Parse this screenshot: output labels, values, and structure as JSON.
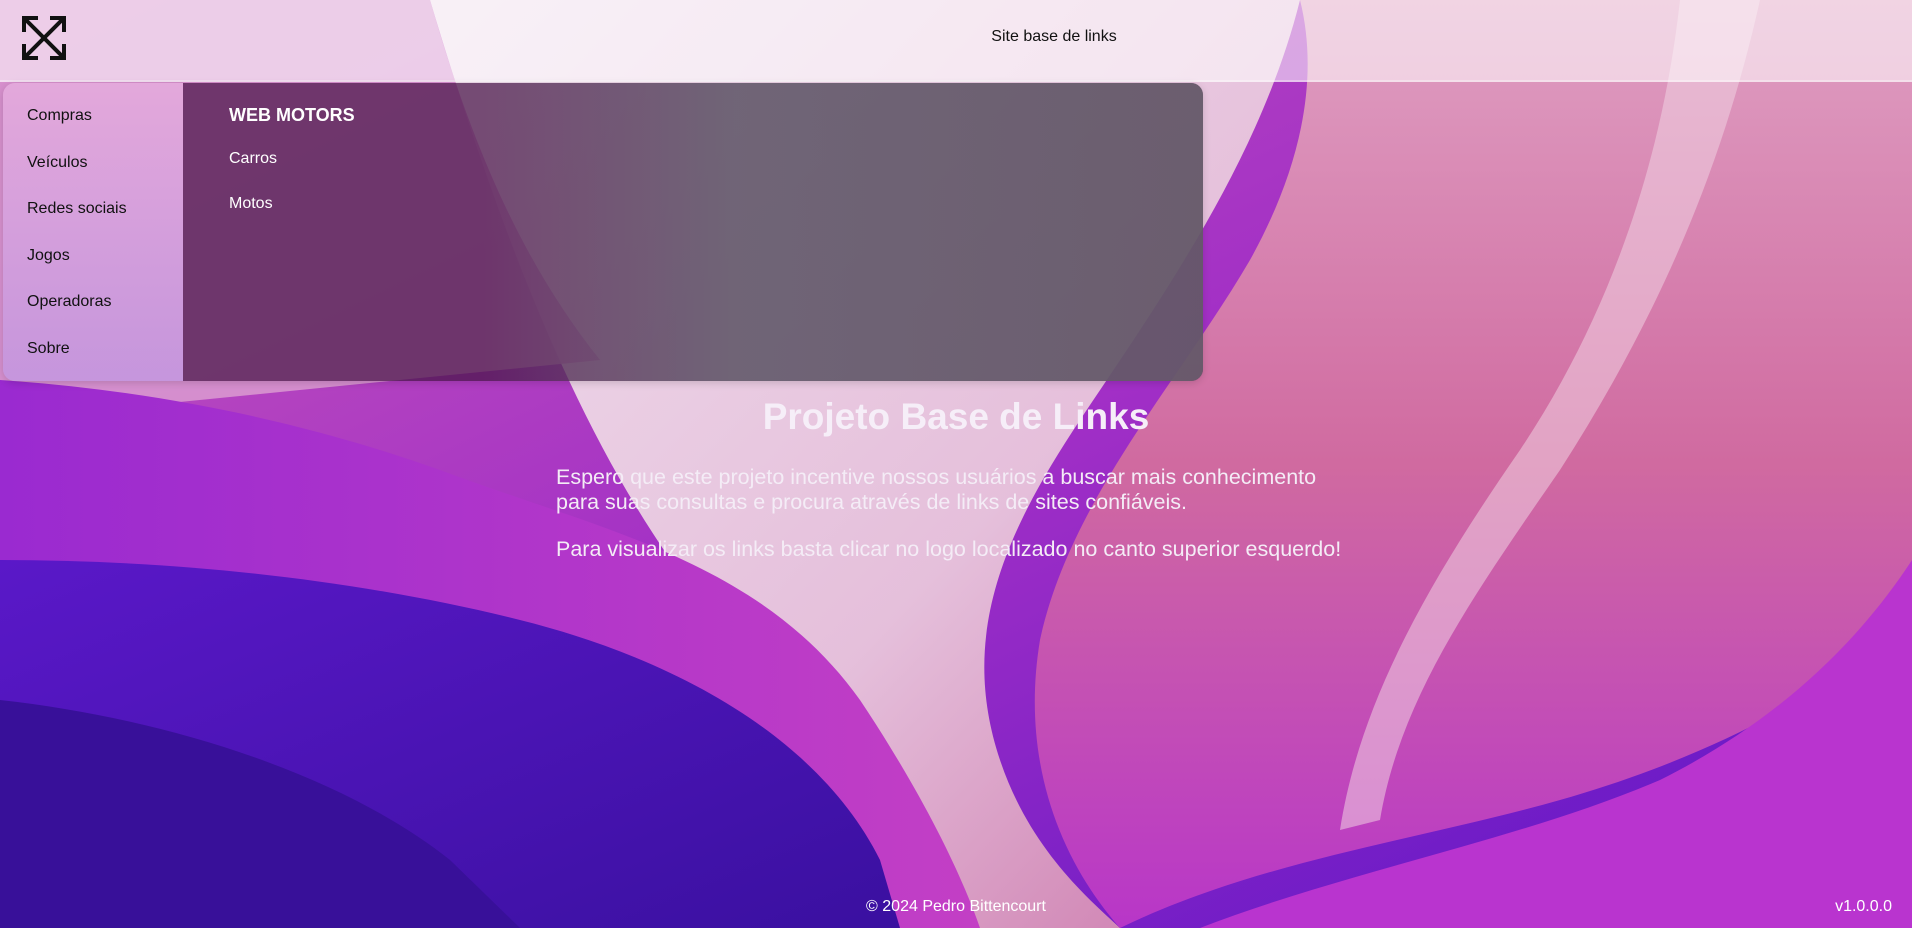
{
  "header": {
    "title": "Site base de links",
    "logo_icon": "expand-arrows-icon"
  },
  "menu": {
    "items": [
      {
        "label": "Compras"
      },
      {
        "label": "Veículos"
      },
      {
        "label": "Redes sociais"
      },
      {
        "label": "Jogos"
      },
      {
        "label": "Operadoras"
      },
      {
        "label": "Sobre"
      }
    ],
    "content": {
      "title": "WEB MOTORS",
      "links": [
        {
          "label": "Carros"
        },
        {
          "label": "Motos"
        }
      ]
    }
  },
  "main": {
    "heading": "Projeto Base de Links",
    "paragraph1": "Espero que este projeto incentive nossos usuários a buscar mais conhecimento para suas consultas e procura através de links de sites confiáveis.",
    "paragraph2": "Para visualizar os links basta clicar no logo localizado no canto superior esquerdo!"
  },
  "footer": {
    "copyright": "© 2024 Pedro Bittencourt",
    "version": "v1.0.0.0"
  },
  "colors": {
    "bg_purple": "#6a1fc9",
    "bg_pink": "#d9709e",
    "bg_light": "#efe3ee",
    "panel_dark": "#5a1a55"
  }
}
